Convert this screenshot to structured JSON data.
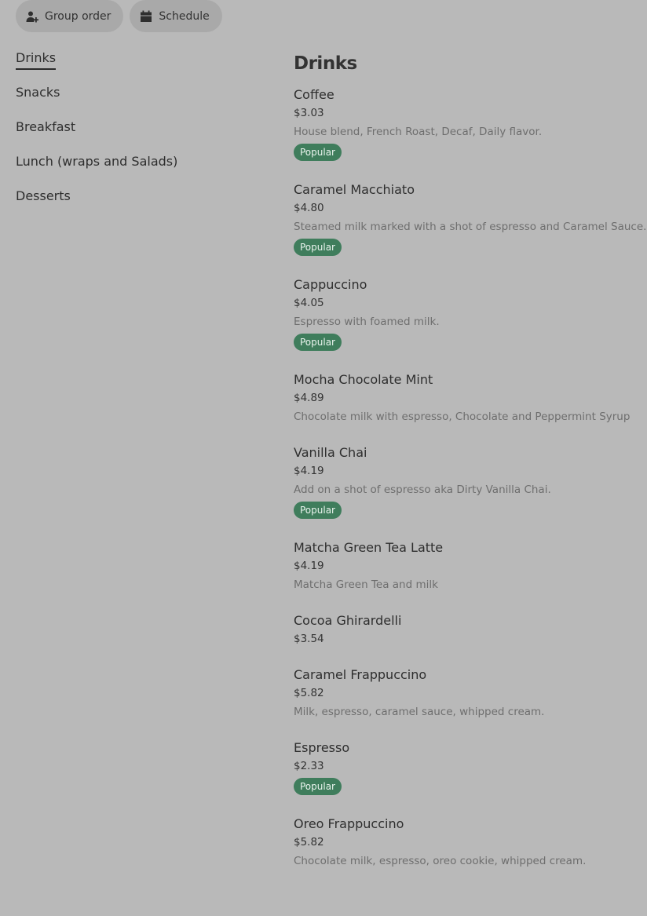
{
  "toolbar": {
    "group_order_label": "Group order",
    "group_order_icon": "person-add-icon",
    "schedule_label": "Schedule",
    "schedule_icon": "calendar-icon"
  },
  "sidebar": {
    "items": [
      {
        "label": "Drinks",
        "active": true
      },
      {
        "label": "Snacks",
        "active": false
      },
      {
        "label": "Breakfast",
        "active": false
      },
      {
        "label": "Lunch (wraps and Salads)",
        "active": false
      },
      {
        "label": "Desserts",
        "active": false
      }
    ]
  },
  "main": {
    "section_title": "Drinks",
    "items": [
      {
        "name": "Coffee",
        "price": "$3.03",
        "description": "House blend, French Roast, Decaf, Daily flavor.",
        "badge": "Popular"
      },
      {
        "name": "Caramel Macchiato",
        "price": "$4.80",
        "description": "Steamed milk marked with a shot of espresso and Caramel Sauce.",
        "badge": "Popular"
      },
      {
        "name": "Cappuccino",
        "price": "$4.05",
        "description": "Espresso with foamed milk.",
        "badge": "Popular"
      },
      {
        "name": "Mocha Chocolate Mint",
        "price": "$4.89",
        "description": "Chocolate milk with espresso, Chocolate and Peppermint Syrup",
        "badge": ""
      },
      {
        "name": "Vanilla Chai",
        "price": "$4.19",
        "description": "Add on a shot of espresso aka Dirty Vanilla Chai.",
        "badge": "Popular"
      },
      {
        "name": "Matcha Green Tea Latte",
        "price": "$4.19",
        "description": "Matcha Green Tea and milk",
        "badge": ""
      },
      {
        "name": "Cocoa Ghirardelli",
        "price": "$3.54",
        "description": "",
        "badge": ""
      },
      {
        "name": "Caramel Frappuccino",
        "price": "$5.82",
        "description": "Milk, espresso, caramel sauce, whipped cream.",
        "badge": ""
      },
      {
        "name": "Espresso",
        "price": "$2.33",
        "description": "",
        "badge": "Popular"
      },
      {
        "name": "Oreo Frappuccino",
        "price": "$5.82",
        "description": "Chocolate milk, espresso, oreo cookie, whipped cream.",
        "badge": ""
      }
    ]
  },
  "colors": {
    "background": "#b9b9b9",
    "pill_background": "#a9a9a9",
    "badge_background": "#3f7d5c",
    "description_text": "#6e6e6e"
  }
}
